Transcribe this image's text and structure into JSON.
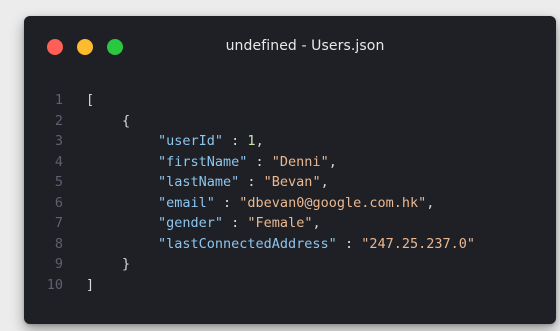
{
  "window": {
    "title": "undefined - Users.json",
    "traffic_lights": [
      {
        "name": "close",
        "color": "#fe5f57"
      },
      {
        "name": "minimize",
        "color": "#febb2e"
      },
      {
        "name": "maximize",
        "color": "#29c840"
      }
    ]
  },
  "editor": {
    "lines": [
      {
        "number": "1",
        "indent": 0,
        "tokens": [
          {
            "type": "punct",
            "text": "["
          }
        ]
      },
      {
        "number": "2",
        "indent": 1,
        "tokens": [
          {
            "type": "punct",
            "text": "{"
          }
        ]
      },
      {
        "number": "3",
        "indent": 2,
        "tokens": [
          {
            "type": "key",
            "text": "\"userId\""
          },
          {
            "type": "punct",
            "text": " : "
          },
          {
            "type": "num",
            "text": "1"
          },
          {
            "type": "punct",
            "text": ","
          }
        ]
      },
      {
        "number": "4",
        "indent": 2,
        "tokens": [
          {
            "type": "key",
            "text": "\"firstName\""
          },
          {
            "type": "punct",
            "text": " : "
          },
          {
            "type": "str",
            "text": "\"Denni\""
          },
          {
            "type": "punct",
            "text": ","
          }
        ]
      },
      {
        "number": "5",
        "indent": 2,
        "tokens": [
          {
            "type": "key",
            "text": "\"lastName\""
          },
          {
            "type": "punct",
            "text": " : "
          },
          {
            "type": "str",
            "text": "\"Bevan\""
          },
          {
            "type": "punct",
            "text": ","
          }
        ]
      },
      {
        "number": "6",
        "indent": 2,
        "tokens": [
          {
            "type": "key",
            "text": "\"email\""
          },
          {
            "type": "punct",
            "text": " : "
          },
          {
            "type": "str",
            "text": "\"dbevan0@google.com.hk\""
          },
          {
            "type": "punct",
            "text": ","
          }
        ]
      },
      {
        "number": "7",
        "indent": 2,
        "tokens": [
          {
            "type": "key",
            "text": "\"gender\""
          },
          {
            "type": "punct",
            "text": " : "
          },
          {
            "type": "str",
            "text": "\"Female\""
          },
          {
            "type": "punct",
            "text": ","
          }
        ]
      },
      {
        "number": "8",
        "indent": 2,
        "tokens": [
          {
            "type": "key",
            "text": "\"lastConnectedAddress\""
          },
          {
            "type": "punct",
            "text": " : "
          },
          {
            "type": "str",
            "text": "\"247.25.237.0\""
          }
        ]
      },
      {
        "number": "9",
        "indent": 1,
        "tokens": [
          {
            "type": "punct",
            "text": "}"
          }
        ]
      },
      {
        "number": "10",
        "indent": 0,
        "tokens": [
          {
            "type": "punct",
            "text": "]"
          }
        ]
      }
    ]
  }
}
